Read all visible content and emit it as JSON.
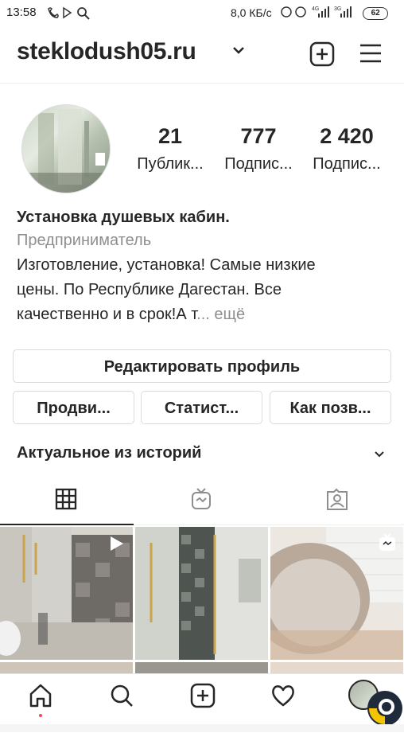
{
  "status_bar": {
    "time": "13:58",
    "network_speed": "8,0 КБ/с",
    "signal1": "4G",
    "signal2": "3G",
    "battery": "62"
  },
  "header": {
    "username": "steklodush05.ru",
    "icons": [
      "chevron-down-icon",
      "new-post-icon",
      "menu-icon"
    ]
  },
  "profile": {
    "stats": [
      {
        "value": "21",
        "label": "Публик..."
      },
      {
        "value": "777",
        "label": "Подпис..."
      },
      {
        "value": "2 420",
        "label": "Подпис..."
      }
    ],
    "name": "Установка душевых кабин.",
    "category": "Предприниматель",
    "bio_lines": [
      "Изготовление, установка! Самые низкие",
      "цены. По Республике Дагестан. Все",
      "качественно и в срок!А т"
    ],
    "bio_ellipsis": "...",
    "bio_more": "ещё"
  },
  "buttons": {
    "edit_profile": "Редактировать профиль",
    "promote": "Продви...",
    "insights": "Статист...",
    "how_to": "Как позв..."
  },
  "highlights": {
    "title": "Актуальное из историй"
  },
  "tabs": [
    {
      "name": "grid",
      "icon": "grid-icon",
      "active": true
    },
    {
      "name": "igtv",
      "icon": "igtv-icon",
      "active": false
    },
    {
      "name": "tagged",
      "icon": "tagged-icon",
      "active": false
    }
  ],
  "posts": [
    {
      "icon": "video-play-icon"
    },
    {
      "icon": ""
    },
    {
      "icon": "igtv-badge-icon"
    }
  ],
  "bottom_nav": [
    "home-icon",
    "search-icon",
    "new-post-icon",
    "heart-icon",
    "profile-avatar"
  ],
  "colors": {
    "text": "#262626",
    "muted": "#8e8e8e",
    "border": "#dbdbdb"
  }
}
